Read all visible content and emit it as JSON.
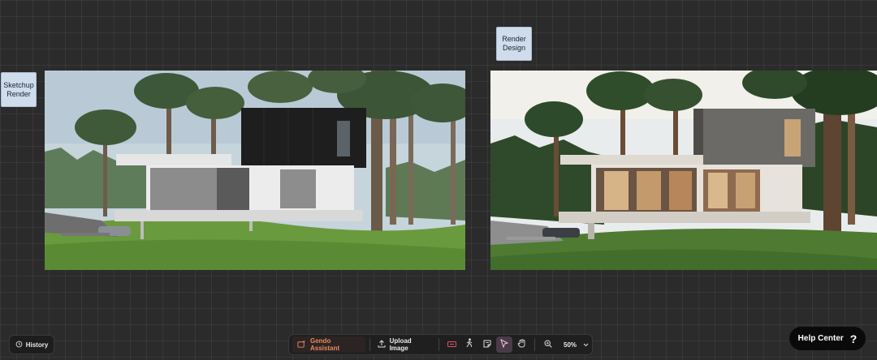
{
  "canvas": {
    "left_label": [
      "Sketchup",
      "Render"
    ],
    "right_label": [
      "Render",
      "Design"
    ]
  },
  "bottom_bar": {
    "history_label": "History",
    "assistant_label": "Gendo Assistant",
    "upload_label": "Upload Image",
    "zoom_level": "50%"
  },
  "help": {
    "label": "Help Center",
    "icon_char": "?"
  },
  "colors": {
    "background": "#2b2b2b",
    "assistant_accent": "#e88a5c",
    "active_tool": "#4a3a4a"
  }
}
